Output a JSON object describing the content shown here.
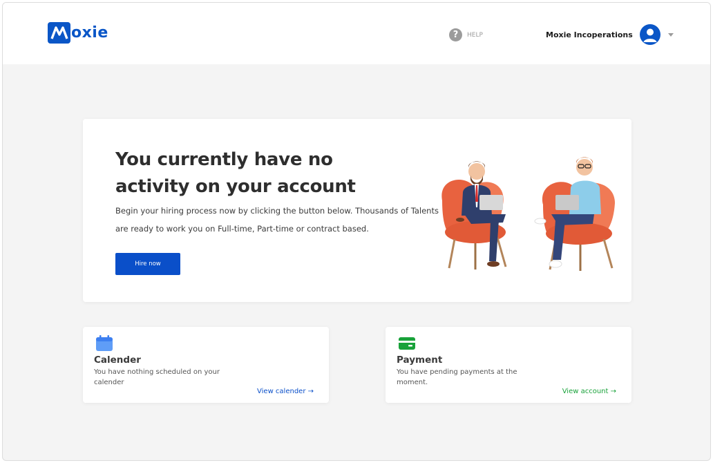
{
  "header": {
    "logo_text": "oxie",
    "logo_letter": "M",
    "help_label": "HELP",
    "account_name": "Moxie Incoperations"
  },
  "hero": {
    "title": "You currently have no activity on your account",
    "description": "Begin your hiring process now by clicking the button below. Thousands of Talents are ready to work you on Full-time, Part-time or contract based.",
    "cta_label": "Hire now"
  },
  "cards": {
    "calendar": {
      "title": "Calender",
      "description": "You have nothing scheduled on your calender",
      "link_label": "View calender →"
    },
    "payment": {
      "title": "Payment",
      "description": "You have pending payments at the moment.",
      "link_label": "View account →"
    }
  },
  "colors": {
    "brand": "#0a56c7",
    "button": "#0a4fc9",
    "payment_accent": "#19a23a",
    "calendar_icon": "#5f9df7"
  },
  "icons": [
    "help-icon",
    "avatar-icon",
    "chevron-down-icon",
    "calendar-icon",
    "credit-card-icon",
    "arrow-right-icon"
  ]
}
